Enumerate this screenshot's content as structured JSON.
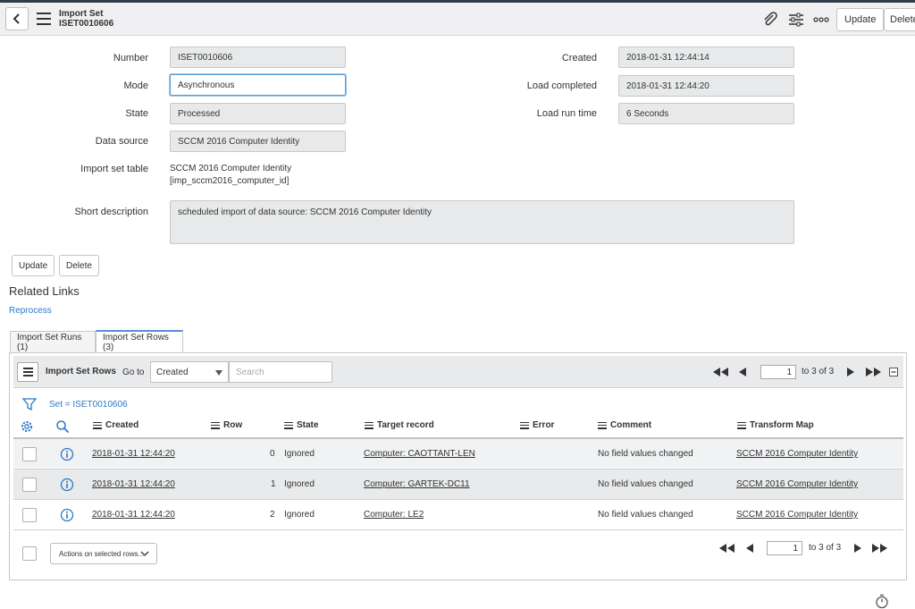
{
  "header": {
    "title": "Import Set",
    "subtitle": "ISET0010606",
    "update_label": "Update",
    "delete_label": "Delete"
  },
  "form": {
    "number_label": "Number",
    "number_value": "ISET0010606",
    "mode_label": "Mode",
    "mode_value": "Asynchronous",
    "state_label": "State",
    "state_value": "Processed",
    "data_source_label": "Data source",
    "data_source_value": "SCCM 2016 Computer Identity",
    "import_set_table_label": "Import set table",
    "import_set_table_value_line1": "SCCM 2016 Computer Identity",
    "import_set_table_value_line2": "[imp_sccm2016_computer_id]",
    "short_description_label": "Short description",
    "short_description_value": "scheduled import of data source: SCCM 2016 Computer Identity",
    "created_label": "Created",
    "created_value": "2018-01-31 12:44:14",
    "load_completed_label": "Load completed",
    "load_completed_value": "2018-01-31 12:44:20",
    "load_run_time_label": "Load run time",
    "load_run_time_value": "6 Seconds"
  },
  "form_buttons": {
    "update_label": "Update",
    "delete_label": "Delete"
  },
  "related_links": {
    "title": "Related Links",
    "reprocess": "Reprocess"
  },
  "tabs": [
    {
      "label": "Import Set Runs (1)"
    },
    {
      "label": "Import Set Rows (3)"
    }
  ],
  "list": {
    "title": "Import Set Rows",
    "goto_label": "Go to",
    "goto_selected": "Created",
    "search_placeholder": "Search",
    "page_value": "1",
    "page_of": "to 3 of 3",
    "filter_text": "Set = ISET0010606",
    "columns": [
      "Created",
      "Row",
      "State",
      "Target record",
      "Error",
      "Comment",
      "Transform Map"
    ],
    "rows": [
      {
        "created": "2018-01-31 12:44:20",
        "row": "0",
        "state": "Ignored",
        "target": "Computer: CAOTTANT-LEN",
        "error": "",
        "comment": "No field values changed",
        "transform": "SCCM 2016 Computer Identity"
      },
      {
        "created": "2018-01-31 12:44:20",
        "row": "1",
        "state": "Ignored",
        "target": "Computer: GARTEK-DC11",
        "error": "",
        "comment": "No field values changed",
        "transform": "SCCM 2016 Computer Identity"
      },
      {
        "created": "2018-01-31 12:44:20",
        "row": "2",
        "state": "Ignored",
        "target": "Computer: LE2",
        "error": "",
        "comment": "No field values changed",
        "transform": "SCCM 2016 Computer Identity"
      }
    ],
    "actions_label": "Actions on selected rows...",
    "footer_page_value": "1",
    "footer_page_of": "to 3 of 3"
  },
  "colors": {
    "accent": "#2a78c5",
    "header_bg": "#f0f0f2",
    "field_bg": "#e8e9ea"
  },
  "icons": {
    "back": "chevron-left-icon",
    "menu": "hamburger-icon",
    "attachment": "paperclip-icon",
    "settings": "sliders-icon",
    "more": "ellipsis-icon",
    "filter": "funnel-icon",
    "gear": "gear-icon",
    "search": "magnifier-icon",
    "info": "info-icon",
    "timer": "stopwatch-icon"
  }
}
